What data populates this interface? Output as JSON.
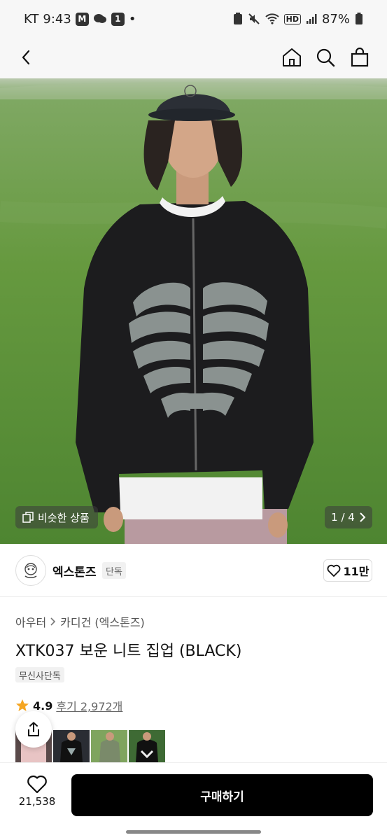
{
  "status_bar": {
    "carrier": "KT",
    "time": "9:43",
    "notif_badge_1": "M",
    "notif_badge_2": "1",
    "dot": "•",
    "hd": "HD",
    "battery": "87%"
  },
  "hero": {
    "similar_label": "비슷한 상품",
    "page_indicator": "1 / 4"
  },
  "brand": {
    "name": "엑스톤즈",
    "exclusive_badge": "단독",
    "likes": "11만"
  },
  "product": {
    "breadcrumb": [
      "아우터",
      "카디건 (엑스톤즈)"
    ],
    "title": "XTK037 보운 니트 집업 (BLACK)",
    "tag": "무신사단독",
    "rating": "4.9",
    "reviews": "후기 2,972개"
  },
  "bottom_bar": {
    "wish_count": "21,538",
    "buy_label": "구매하기"
  },
  "colors": {
    "accent_star": "#f5a623",
    "buy_button": "#000000"
  },
  "icons": [
    "back-icon",
    "home-icon",
    "search-icon",
    "bag-icon",
    "copy-icon",
    "chevron-right-icon",
    "heart-icon",
    "star-icon",
    "share-icon"
  ]
}
